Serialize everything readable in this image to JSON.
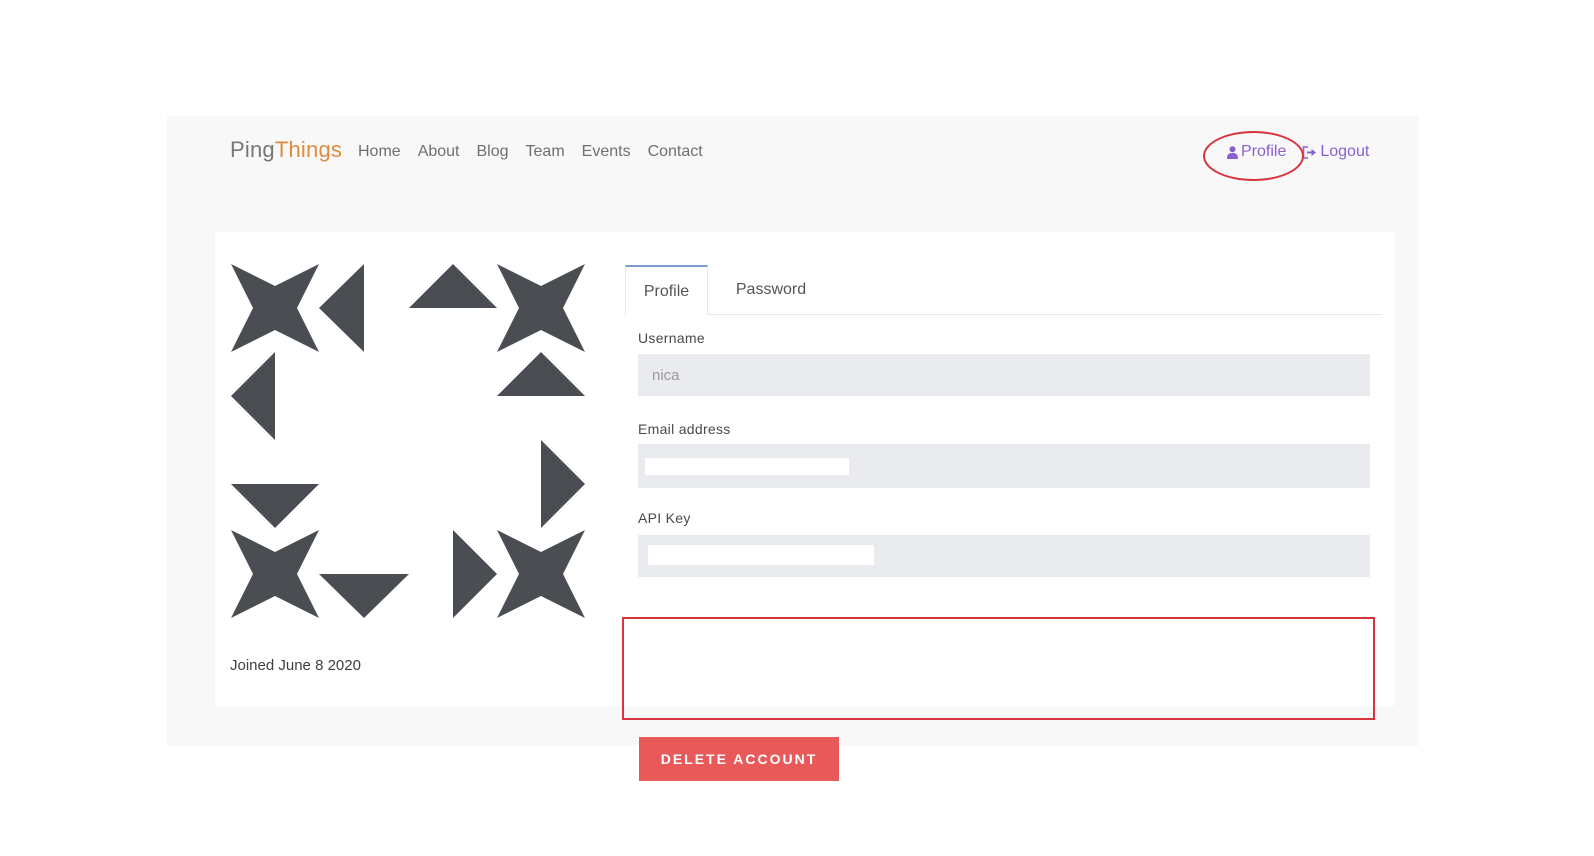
{
  "brand": {
    "part1": "Ping",
    "part2": "Things"
  },
  "nav": {
    "links": [
      "Home",
      "About",
      "Blog",
      "Team",
      "Events",
      "Contact"
    ],
    "profile_label": "Profile",
    "logout_label": "Logout"
  },
  "tabs": [
    {
      "label": "Profile",
      "active": true
    },
    {
      "label": "Password",
      "active": false
    }
  ],
  "form": {
    "username_label": "Username",
    "username_value": "nica",
    "email_label": "Email address",
    "email_value": "",
    "api_key_label": "API Key",
    "api_key_value": ""
  },
  "delete_button": "DELETE ACCOUNT",
  "joined_text": "Joined June 8 2020",
  "colors": {
    "brand_things": "#e08a3c",
    "nav_right": "#8a5fd0",
    "annotation": "#d8343e",
    "delete_button": "#e85a5a",
    "identicon": "#4a4e52"
  },
  "icons": [
    "user-icon",
    "logout-icon"
  ]
}
